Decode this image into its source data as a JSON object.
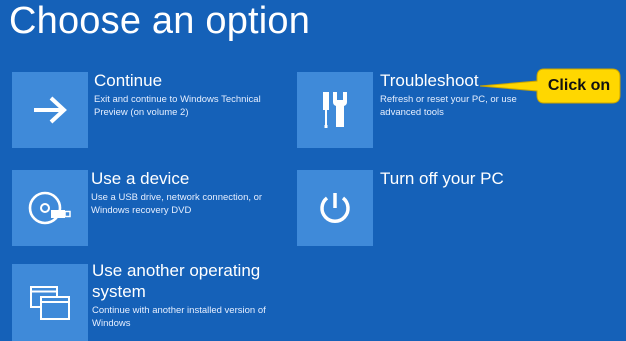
{
  "page": {
    "title": "Choose an option"
  },
  "options": {
    "continue": {
      "label": "Continue",
      "description": "Exit and continue to Windows Technical Preview (on volume 2)",
      "icon": "arrow-right-icon"
    },
    "use_device": {
      "label": "Use a device",
      "description": "Use a USB drive, network connection, or Windows recovery DVD",
      "icon": "disc-icon"
    },
    "another_os": {
      "label": "Use another operating system",
      "description": "Continue with another installed version of Windows",
      "icon": "windows-stack-icon"
    },
    "troubleshoot": {
      "label": "Troubleshoot",
      "description": "Refresh or reset your PC, or use advanced tools",
      "icon": "tools-icon"
    },
    "turn_off": {
      "label": "Turn off your PC",
      "description": "",
      "icon": "power-icon"
    }
  },
  "callout": {
    "text": "Click on",
    "color": "#ffd700"
  },
  "colors": {
    "background": "#1561b8",
    "tile": "#3f8ad9",
    "text": "#ffffff"
  }
}
